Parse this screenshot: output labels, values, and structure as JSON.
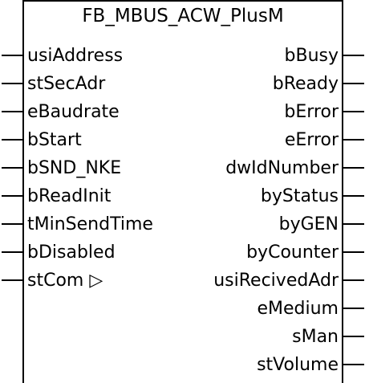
{
  "block": {
    "title": "FB_MBUS_ACW_PlusM"
  },
  "inputs": [
    {
      "label": "usiAddress"
    },
    {
      "label": "stSecAdr"
    },
    {
      "label": "eBaudrate"
    },
    {
      "label": "bStart"
    },
    {
      "label": "bSND_NKE"
    },
    {
      "label": "bReadInit"
    },
    {
      "label": "tMinSendTime"
    },
    {
      "label": "bDisabled"
    },
    {
      "label": "stCom ▷"
    }
  ],
  "outputs": [
    {
      "label": "bBusy"
    },
    {
      "label": "bReady"
    },
    {
      "label": "bError"
    },
    {
      "label": "eError"
    },
    {
      "label": "dwIdNumber"
    },
    {
      "label": "byStatus"
    },
    {
      "label": "byGEN"
    },
    {
      "label": "byCounter"
    },
    {
      "label": "usiRecivedAdr"
    },
    {
      "label": "eMedium"
    },
    {
      "label": "sMan"
    },
    {
      "label": "stVolume"
    }
  ]
}
